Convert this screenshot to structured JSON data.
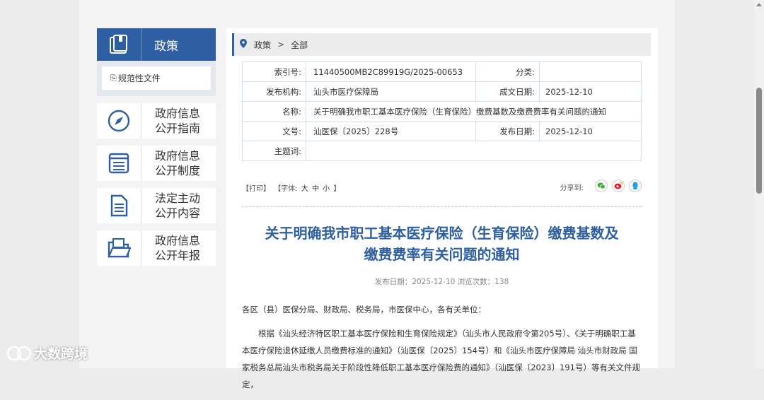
{
  "sidebar": {
    "header": {
      "label": "政策",
      "icon": "book-icon"
    },
    "sub_item": "规范性文件",
    "cards": [
      {
        "line1": "政府信息",
        "line2": "公开指南",
        "icon": "compass-icon"
      },
      {
        "line1": "政府信息",
        "line2": "公开制度",
        "icon": "list-icon"
      },
      {
        "line1": "法定主动",
        "line2": "公开内容",
        "icon": "document-icon"
      },
      {
        "line1": "政府信息",
        "line2": "公开年报",
        "icon": "folder-icon"
      }
    ]
  },
  "breadcrumb": {
    "item1": "政策",
    "sep": ">",
    "item2": "全部"
  },
  "meta": {
    "index_label": "索引号:",
    "index_value": "11440500MB2C89919G/2025-00653",
    "category_label": "分类:",
    "category_value": "",
    "org_label": "发布机构:",
    "org_value": "汕头市医疗保障局",
    "date_label": "成文日期:",
    "date_value": "2025-12-10",
    "name_label": "名称:",
    "name_value": "关于明确我市职工基本医疗保险（生育保险）缴费基数及缴费费率有关问题的通知",
    "docno_label": "文号:",
    "docno_value": "汕医保〔2025〕228号",
    "pubdate_label": "发布日期:",
    "pubdate_value": "2025-12-10",
    "keyword_label": "主题词:",
    "keyword_value": ""
  },
  "toolbar": {
    "print": "【打印】",
    "font_open": "【字体:",
    "font_large": "大",
    "font_medium": "中",
    "font_small": "小",
    "font_close": "】",
    "share_label": "分享到:"
  },
  "article": {
    "title_line1": "关于明确我市职工基本医疗保险（生育保险）缴费基数及",
    "title_line2": "缴费费率有关问题的通知",
    "publish_info": "发布日期：2025-12-10   浏览次数：138",
    "para1": "各区（县）医保分局、财政局、税务局，市医保中心，各有关单位：",
    "para2": "根据《汕头经济特区职工基本医疗保险和生育保险规定》（汕头市人民政府令第205号）、《关于明确职工基本医疗保险退休延缴人员缴费标准的通知》（汕医保〔2025〕154号）和《汕头市医疗保障局 汕头市财政局 国家税务总局汕头市税务局关于阶段性降低职工基本医疗保险费的通知》（汕医保〔2023〕191号）等有关文件规定，"
  },
  "watermark": "大数跨境",
  "colors": {
    "accent": "#2e5fa3",
    "title": "#2e5fa3"
  }
}
